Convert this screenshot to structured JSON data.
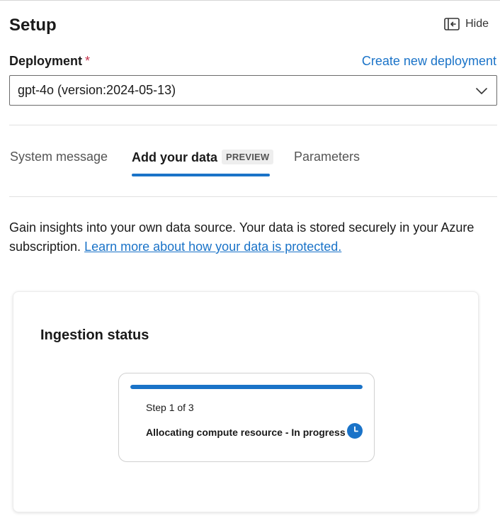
{
  "header": {
    "title": "Setup",
    "hide_label": "Hide",
    "hide_icon": "panel-collapse-icon"
  },
  "deployment": {
    "label": "Deployment",
    "required_marker": "*",
    "create_link": "Create new deployment",
    "selected": "gpt-4o (version:2024-05-13)"
  },
  "tabs": [
    {
      "label": "System message",
      "active": false
    },
    {
      "label": "Add your data",
      "badge": "PREVIEW",
      "active": true
    },
    {
      "label": "Parameters",
      "active": false
    }
  ],
  "description": {
    "text": "Gain insights into your own data source. Your data is stored securely in your Azure subscription. ",
    "link": "Learn more about how your data is protected."
  },
  "ingestion": {
    "title": "Ingestion status",
    "step": "Step 1 of 3",
    "status": "Allocating compute resource - In progress",
    "progress": 1.0,
    "status_icon": "clock-icon"
  },
  "colors": {
    "accent": "#1a73c8",
    "required": "#c4314b"
  }
}
